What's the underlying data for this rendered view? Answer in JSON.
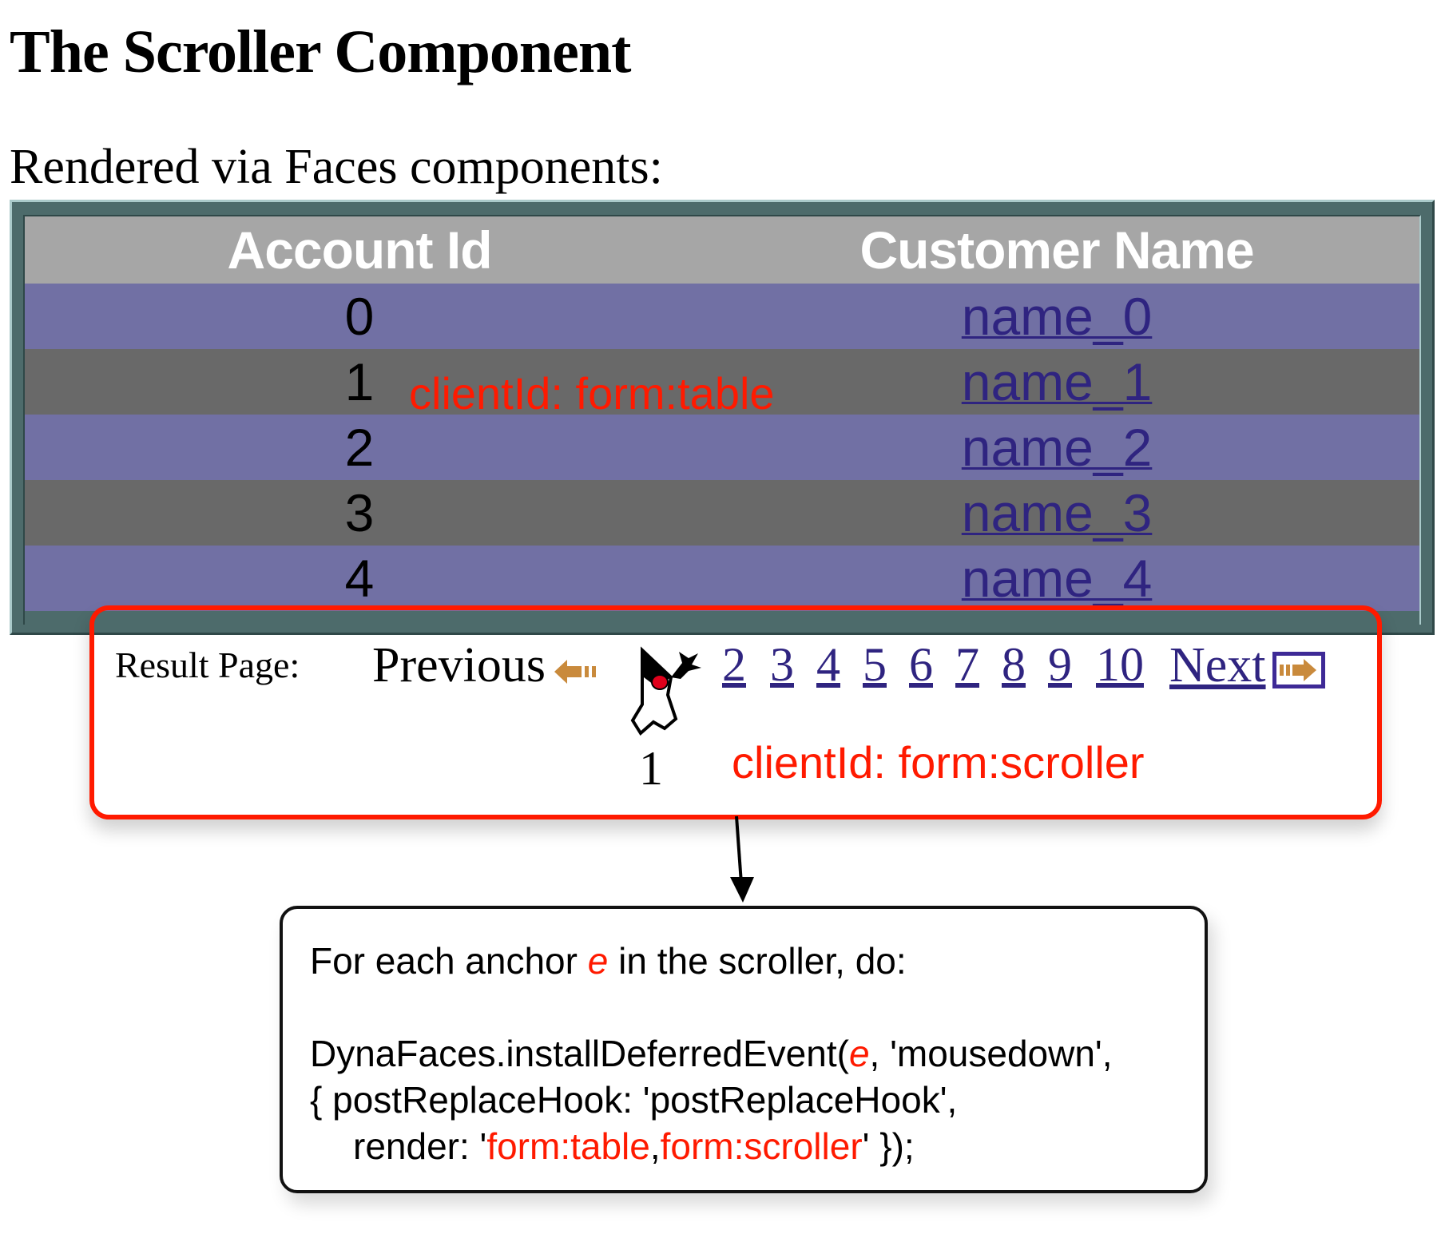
{
  "page": {
    "title": "The Scroller Component",
    "subtitle": "Rendered via Faces components:"
  },
  "table": {
    "headers": [
      "Account Id",
      "Customer Name"
    ],
    "rows": [
      {
        "id": "0",
        "name": "name_0"
      },
      {
        "id": "1",
        "name": "name_1"
      },
      {
        "id": "2",
        "name": "name_2"
      },
      {
        "id": "3",
        "name": "name_3"
      },
      {
        "id": "4",
        "name": "name_4"
      }
    ],
    "annotation": "clientId: form:table"
  },
  "scroller": {
    "label": "Result Page:",
    "previous": "Previous",
    "current_page": "1",
    "pages": [
      "2",
      "3",
      "4",
      "5",
      "6",
      "7",
      "8",
      "9",
      "10"
    ],
    "next": "Next",
    "annotation": "clientId: form:scroller"
  },
  "code": {
    "line1_pre": "For each anchor ",
    "line1_var": "e",
    "line1_post": " in the scroller, do:",
    "line2_pre": "DynaFaces.installDeferredEvent(",
    "line2_var": "e",
    "line2_post": ", 'mousedown',",
    "line3": "{ postReplaceHook: 'postReplaceHook',",
    "line4_pre": "render: '",
    "line4_red1": "form:table",
    "line4_comma": ",",
    "line4_red2": "form:scroller",
    "line4_post": "' });"
  },
  "colors": {
    "annotation": "#ff1a00",
    "row_odd": "#7170a4",
    "row_even": "#696969",
    "header": "#a6a6a6",
    "link": "#2f2480"
  }
}
